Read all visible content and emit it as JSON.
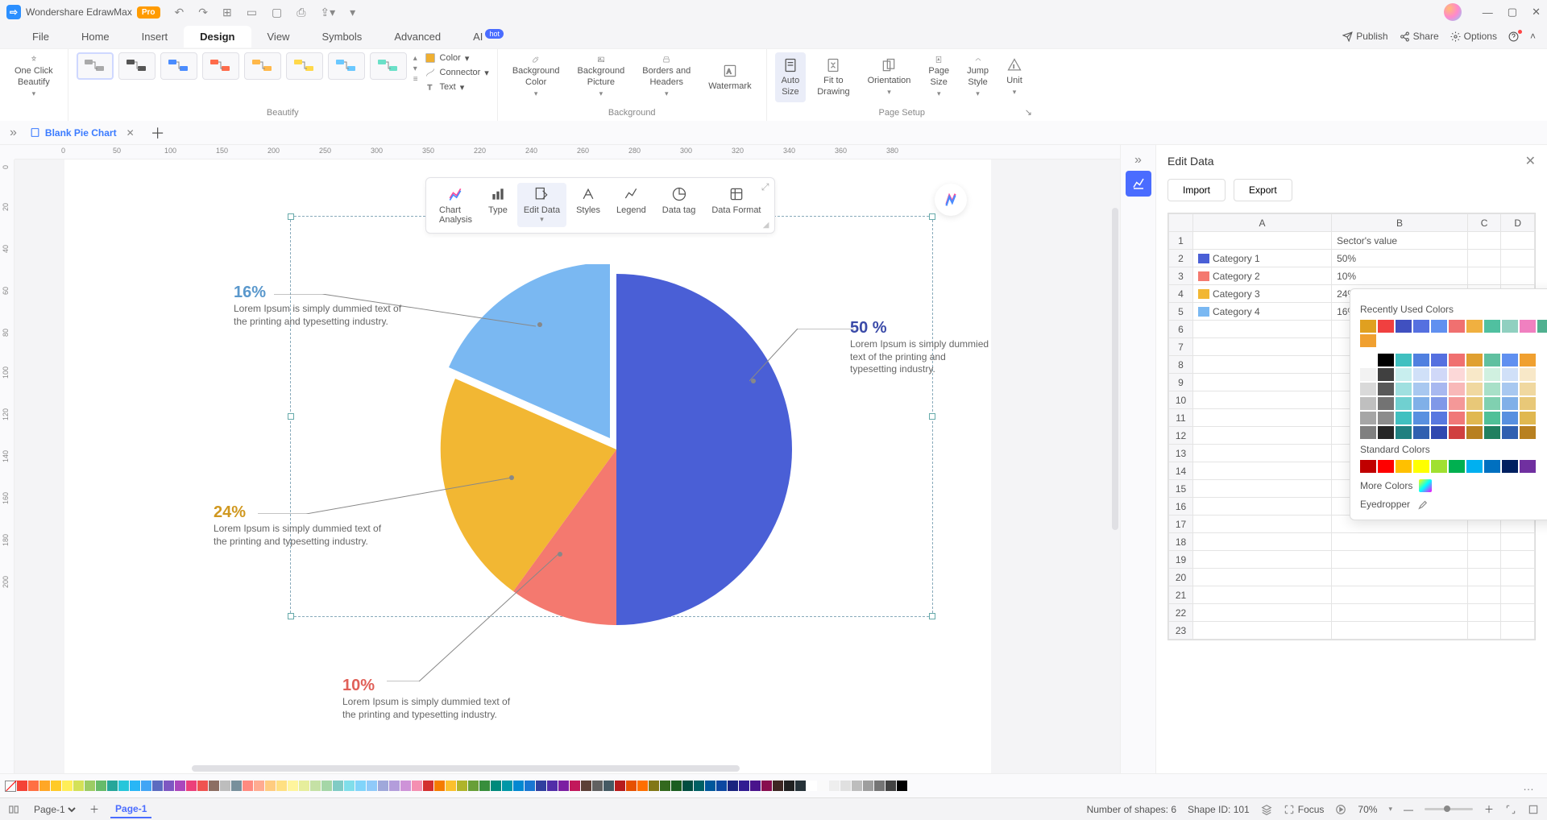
{
  "app": {
    "name": "Wondershare EdrawMax",
    "badge": "Pro"
  },
  "menu": {
    "file": "File",
    "home": "Home",
    "insert": "Insert",
    "design": "Design",
    "view": "View",
    "symbols": "Symbols",
    "advanced": "Advanced",
    "ai": "AI",
    "hot": "hot"
  },
  "top_right": {
    "publish": "Publish",
    "share": "Share",
    "options": "Options"
  },
  "ribbon": {
    "one_click": "One Click\nBeautify",
    "beautify_label": "Beautify",
    "color": "Color",
    "connector": "Connector",
    "text": "Text",
    "bg_color": "Background\nColor",
    "bg_pic": "Background\nPicture",
    "borders": "Borders and\nHeaders",
    "watermark": "Watermark",
    "bg_label": "Background",
    "auto_size": "Auto\nSize",
    "fit": "Fit to\nDrawing",
    "orientation": "Orientation",
    "page_size": "Page\nSize",
    "jump_style": "Jump\nStyle",
    "unit": "Unit",
    "page_setup_label": "Page Setup"
  },
  "tab": {
    "name": "Blank Pie Chart"
  },
  "ruler_h": [
    "0",
    "50",
    "100",
    "150",
    "200",
    "250",
    "300",
    "350"
  ],
  "ruler_v": [
    "0",
    "20",
    "40",
    "60",
    "80",
    "100",
    "120",
    "140",
    "160",
    "180",
    "200"
  ],
  "chart_toolbar": {
    "analysis": "Chart\nAnalysis",
    "type": "Type",
    "edit": "Edit Data",
    "styles": "Styles",
    "legend": "Legend",
    "datatag": "Data tag",
    "format": "Data Format"
  },
  "chart_data": {
    "type": "pie",
    "title": "",
    "categories": [
      "Category 1",
      "Category 2",
      "Category 3",
      "Category 4"
    ],
    "values": [
      50,
      10,
      24,
      16
    ],
    "colors": [
      "#4a5fd6",
      "#f4796f",
      "#f2b733",
      "#7ab8f2"
    ],
    "label_suffix": "%",
    "callouts": {
      "c1": {
        "pct": "50 %",
        "text": "Lorem Ipsum is simply dummied text of the printing and typesetting industry."
      },
      "c2": {
        "pct": "10%",
        "text": "Lorem Ipsum is simply dummied text of the printing and typesetting industry."
      },
      "c3": {
        "pct": "24%",
        "text": "Lorem Ipsum is simply dummied text of the printing and typesetting industry."
      },
      "c4": {
        "pct": "16%",
        "text": "Lorem Ipsum is simply dummied text of the printing and typesetting industry."
      }
    }
  },
  "edit_panel": {
    "title": "Edit Data",
    "import": "Import",
    "export": "Export",
    "cols": [
      "A",
      "B",
      "C",
      "D"
    ],
    "header_b": "Sector's value",
    "rows": [
      {
        "n": "1",
        "a": "",
        "b": "Sector's value"
      },
      {
        "n": "2",
        "sw": "#4a5fd6",
        "a": "Category 1",
        "b": "50%"
      },
      {
        "n": "3",
        "sw": "#f4796f",
        "a": "Category 2",
        "b": "10%"
      },
      {
        "n": "4",
        "sw": "#f2b733",
        "a": "Category 3",
        "b": "24%"
      },
      {
        "n": "5",
        "sw": "#7ab8f2",
        "a": "Category 4",
        "b": "16%"
      }
    ],
    "blank_rows": [
      "6",
      "7",
      "8",
      "9",
      "10",
      "11",
      "12",
      "13",
      "14",
      "15",
      "16",
      "17",
      "18",
      "19",
      "20",
      "21",
      "22",
      "23"
    ]
  },
  "colorpop": {
    "recent_label": "Recently Used Colors",
    "standard_label": "Standard Colors",
    "more": "More Colors",
    "eyedropper": "Eyedropper",
    "recent": [
      "#e0a020",
      "#f04040",
      "#4050c0",
      "#5570e0",
      "#6090f0",
      "#f07070",
      "#f0b040",
      "#50c0a0",
      "#90d0c0",
      "#f080c0",
      "#50b090",
      "#f0a030"
    ],
    "theme_row0": [
      "#ffffff",
      "#000000",
      "#40c0c0",
      "#5080e0",
      "#5570e0",
      "#f07070",
      "#e0a030",
      "#60c0a0",
      "#6090f0",
      "#f0a030"
    ],
    "theme_shades": [
      [
        "#f2f2f2",
        "#404040",
        "#c8eeee",
        "#d0e0f8",
        "#d0d8f8",
        "#fcd8d8",
        "#f8e8c8",
        "#d0f0e0",
        "#d0e0f8",
        "#f8e8c8"
      ],
      [
        "#d9d9d9",
        "#595959",
        "#a0e0e0",
        "#a8c8f0",
        "#a8b8f0",
        "#f8b8b8",
        "#f0d8a0",
        "#a8e0c8",
        "#a8c8f0",
        "#f0d8a0"
      ],
      [
        "#bfbfbf",
        "#737373",
        "#70d0d0",
        "#80b0e8",
        "#8098e8",
        "#f49898",
        "#e8c878",
        "#80d0b0",
        "#80b0e8",
        "#e8c878"
      ],
      [
        "#a6a6a6",
        "#8c8c8c",
        "#40c0c0",
        "#5890e0",
        "#5878e0",
        "#f07878",
        "#e0b850",
        "#50c098",
        "#5890e0",
        "#e0b850"
      ],
      [
        "#808080",
        "#262626",
        "#208080",
        "#3060b0",
        "#3048b0",
        "#d04040",
        "#b88020",
        "#208060",
        "#3060b0",
        "#b88020"
      ]
    ],
    "standard": [
      "#c00000",
      "#ff0000",
      "#ffc000",
      "#ffff00",
      "#a0e030",
      "#00b050",
      "#00b0f0",
      "#0070c0",
      "#002060",
      "#7030a0"
    ]
  },
  "quick_colors": [
    "#f44336",
    "#ff7043",
    "#ffa726",
    "#ffca28",
    "#ffee58",
    "#d4e157",
    "#9ccc65",
    "#66bb6a",
    "#26a69a",
    "#26c6da",
    "#29b6f6",
    "#42a5f5",
    "#5c6bc0",
    "#7e57c2",
    "#ab47bc",
    "#ec407a",
    "#ef5350",
    "#8d6e63",
    "#bdbdbd",
    "#78909c",
    "#ff8a80",
    "#ffab91",
    "#ffcc80",
    "#ffe082",
    "#fff59d",
    "#e6ee9c",
    "#c5e1a5",
    "#a5d6a7",
    "#80cbc4",
    "#80deea",
    "#81d4fa",
    "#90caf9",
    "#9fa8da",
    "#b39ddb",
    "#ce93d8",
    "#f48fb1",
    "#d32f2f",
    "#f57c00",
    "#fbc02d",
    "#afb42b",
    "#689f38",
    "#388e3c",
    "#00897b",
    "#0097a7",
    "#0288d1",
    "#1976d2",
    "#303f9f",
    "#512da8",
    "#7b1fa2",
    "#c2185b",
    "#5d4037",
    "#616161",
    "#455a64",
    "#b71c1c",
    "#e65100",
    "#ff6f00",
    "#827717",
    "#33691e",
    "#1b5e20",
    "#004d40",
    "#006064",
    "#01579b",
    "#0d47a1",
    "#1a237e",
    "#311b92",
    "#4a148c",
    "#880e4f",
    "#3e2723",
    "#212121",
    "#263238",
    "#ffffff",
    "#fafafa",
    "#eeeeee",
    "#e0e0e0",
    "#bdbdbd",
    "#9e9e9e",
    "#757575",
    "#424242",
    "#000000"
  ],
  "status": {
    "page_sel": "Page-1",
    "page_active": "Page-1",
    "shapes": "Number of shapes: 6",
    "shape_id": "Shape ID: 101",
    "focus": "Focus",
    "zoom": "70%"
  }
}
